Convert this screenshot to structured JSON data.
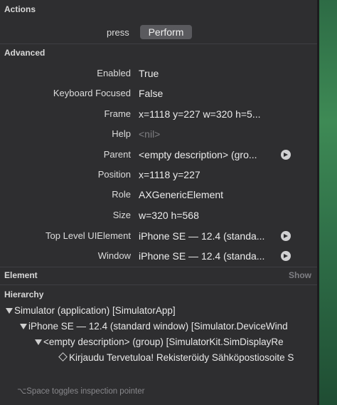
{
  "sections": {
    "actions": "Actions",
    "advanced": "Advanced",
    "element": "Element",
    "hierarchy": "Hierarchy"
  },
  "actions": {
    "label": "press",
    "button": "Perform"
  },
  "advanced": [
    {
      "label": "Enabled",
      "value": "True"
    },
    {
      "label": "Keyboard Focused",
      "value": "False"
    },
    {
      "label": "Frame",
      "value": "x=1118 y=227 w=320 h=5..."
    },
    {
      "label": "Help",
      "value": "<nil>"
    },
    {
      "label": "Parent",
      "value": "<empty description> (gro..."
    },
    {
      "label": "Position",
      "value": "x=1118 y=227"
    },
    {
      "label": "Role",
      "value": "AXGenericElement"
    },
    {
      "label": "Size",
      "value": "w=320 h=568"
    },
    {
      "label": "Top Level UIElement",
      "value": "iPhone SE — 12.4 (standa..."
    },
    {
      "label": "Window",
      "value": "iPhone SE — 12.4 (standa..."
    }
  ],
  "element": {
    "show_link": "Show"
  },
  "hierarchy": [
    "Simulator (application) [SimulatorApp]",
    "iPhone SE — 12.4 (standard window) [Simulator.DeviceWind",
    "<empty description> (group) [SimulatorKit.SimDisplayRe",
    "Kirjaudu Tervetuloa! Rekisteröidy Sähköpostiosoite S"
  ],
  "footer": "⌥Space toggles inspection pointer",
  "colors": {
    "panel": "#2e2e30",
    "button": "#5a5a5e",
    "muted": "#7e7e82"
  }
}
